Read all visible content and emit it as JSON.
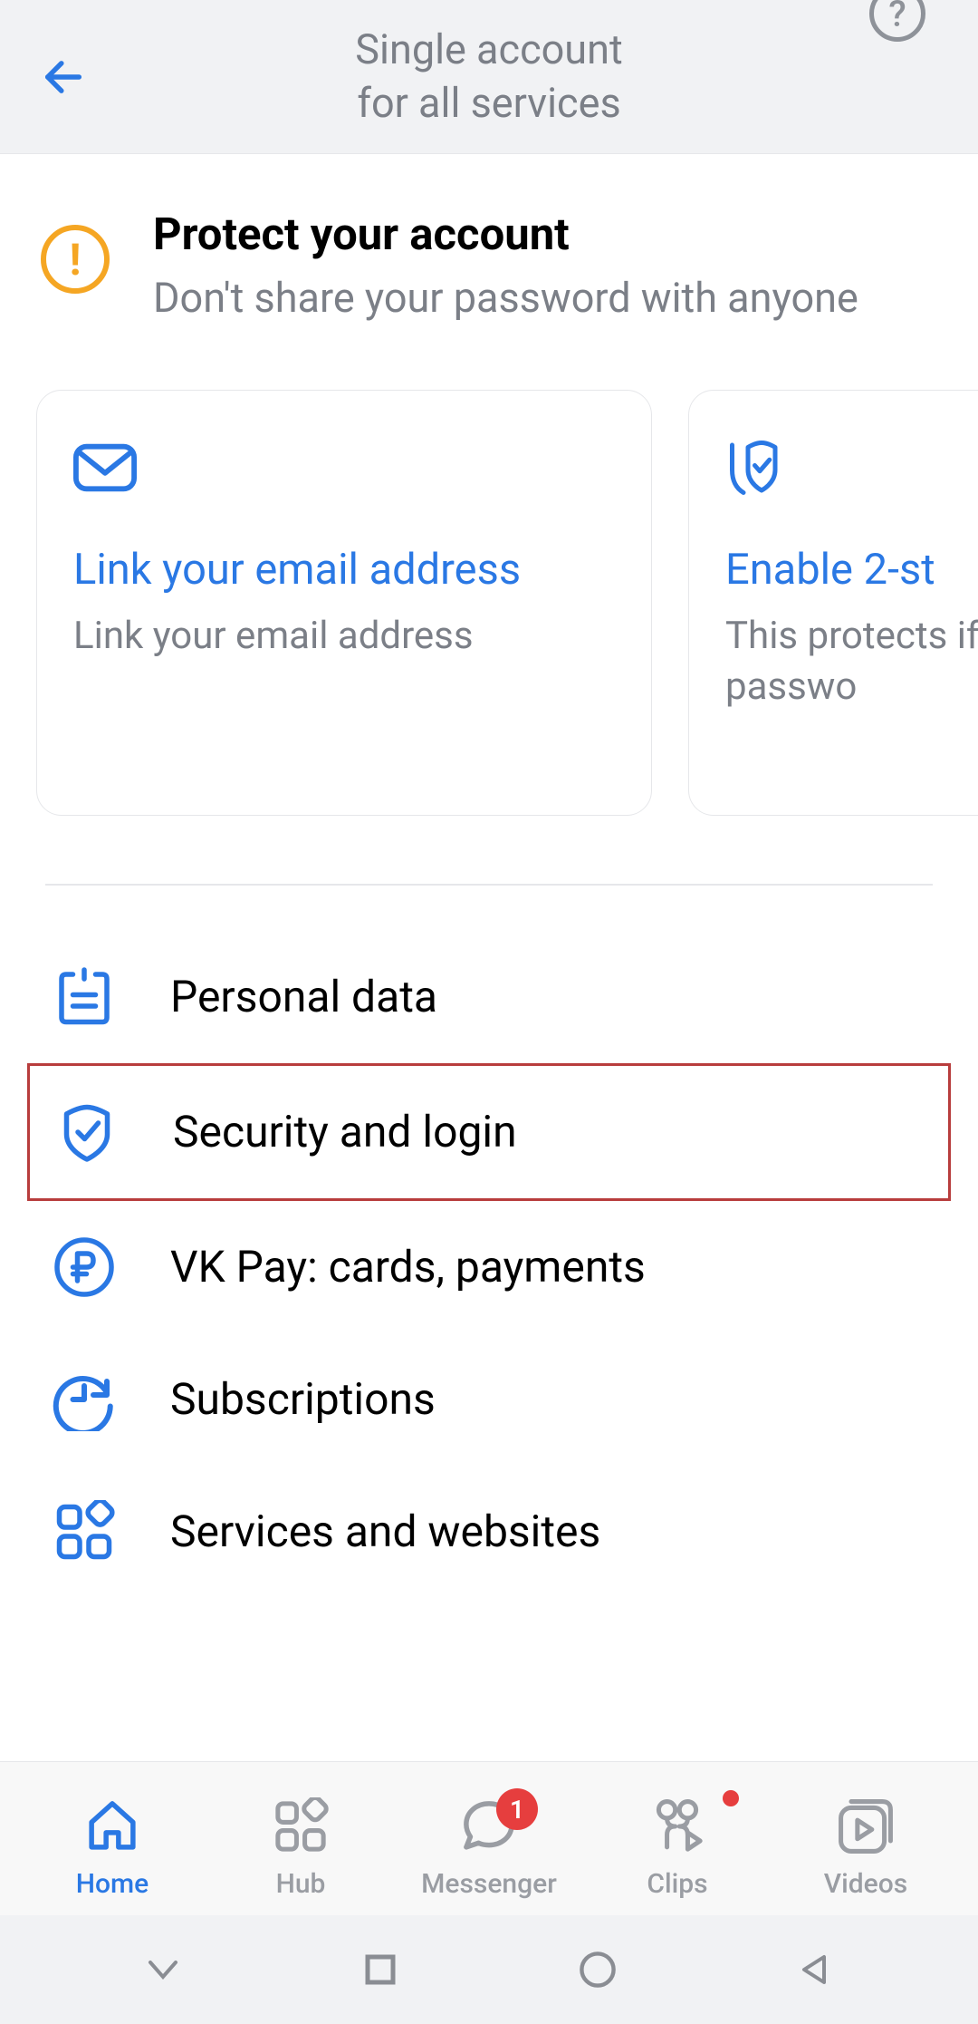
{
  "header": {
    "title_line1": "Single account",
    "title_line2": "for all services"
  },
  "protect": {
    "title": "Protect your account",
    "subtitle": "Don't share your password with anyone"
  },
  "cards": [
    {
      "title": "Link your email address",
      "subtitle": "Link your email address"
    },
    {
      "title": "Enable 2-st",
      "subtitle": "This protects if someone g your passwo"
    }
  ],
  "menu": [
    {
      "label": "Personal data",
      "highlighted": false
    },
    {
      "label": "Security and login",
      "highlighted": true
    },
    {
      "label": "VK Pay: cards, payments",
      "highlighted": false
    },
    {
      "label": "Subscriptions",
      "highlighted": false
    },
    {
      "label": "Services and websites",
      "highlighted": false
    }
  ],
  "nav": {
    "home": "Home",
    "hub": "Hub",
    "messenger": "Messenger",
    "messenger_badge": "1",
    "clips": "Clips",
    "videos": "Videos"
  }
}
